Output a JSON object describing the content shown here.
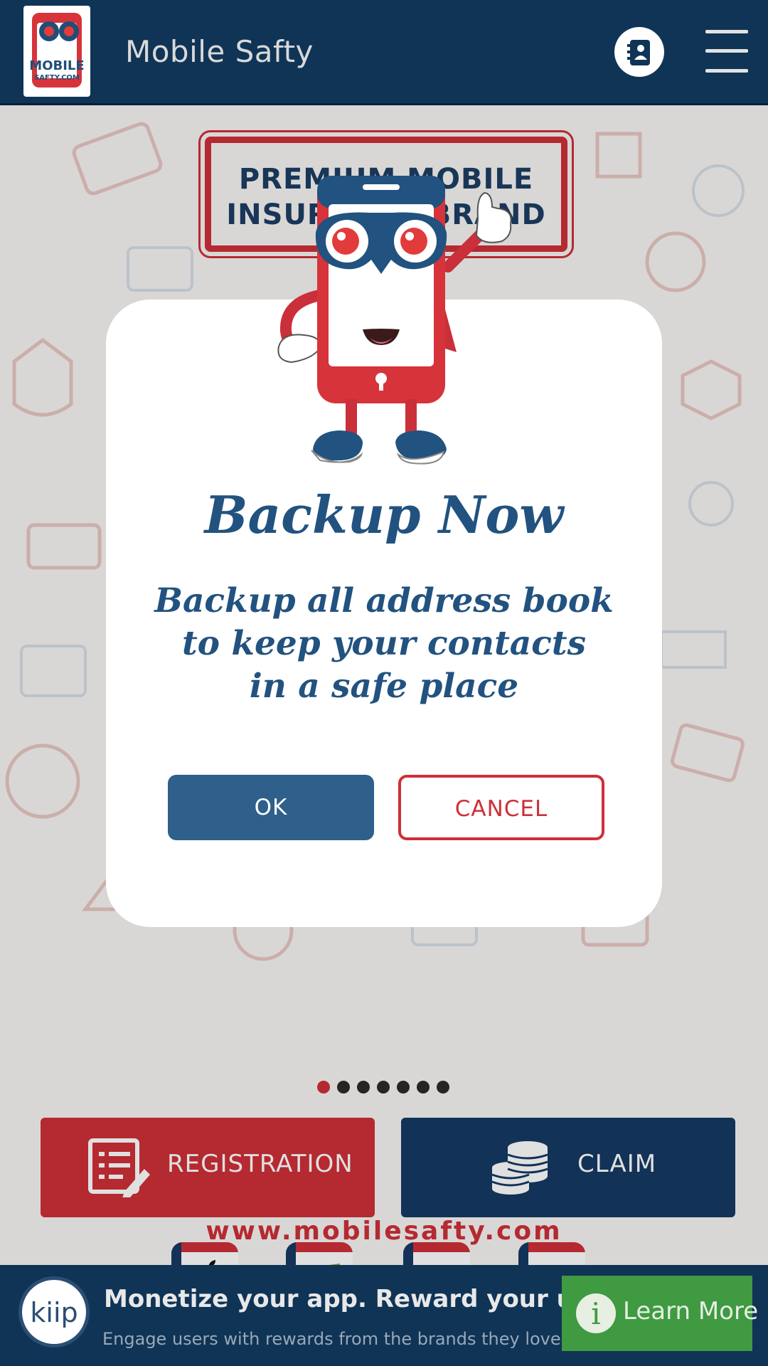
{
  "app_bar": {
    "title": "Mobile Safty",
    "logo_text_top": "MOBILE",
    "logo_text_bottom": "SAFTY.COM",
    "contact_icon": "contact-book-icon",
    "menu_icon": "hamburger-menu-icon"
  },
  "banner": {
    "stamp_line1": "PREMIUM MOBILE",
    "stamp_line2": "INSURANCE BRAND",
    "partial_text": "y",
    "slides_count": 7,
    "active_slide": 1
  },
  "actions": {
    "registration_label": "REGISTRATION",
    "claim_label": "CLAIM",
    "registration_icon": "form-edit-icon",
    "claim_icon": "coin-stack-icon"
  },
  "platforms": [
    "apple-icon",
    "windows-icon",
    "android-icon",
    "blackberry-icon"
  ],
  "website": "www.mobilesafty.com",
  "dialog": {
    "title": "Backup Now",
    "body_lines": [
      "Backup all address book",
      "to keep your contacts",
      "in a safe place"
    ],
    "ok_label": "OK",
    "cancel_label": "CANCEL"
  },
  "ad": {
    "brand": "kiip",
    "title": "Monetize your app. Reward your users.",
    "subtitle": "Engage users with rewards from the brands they love.",
    "cta": "Learn More"
  },
  "colors": {
    "navy": "#0f3456",
    "red": "#cf2f38",
    "dialog_text": "#22527f",
    "ad_green": "#3f9a42"
  }
}
